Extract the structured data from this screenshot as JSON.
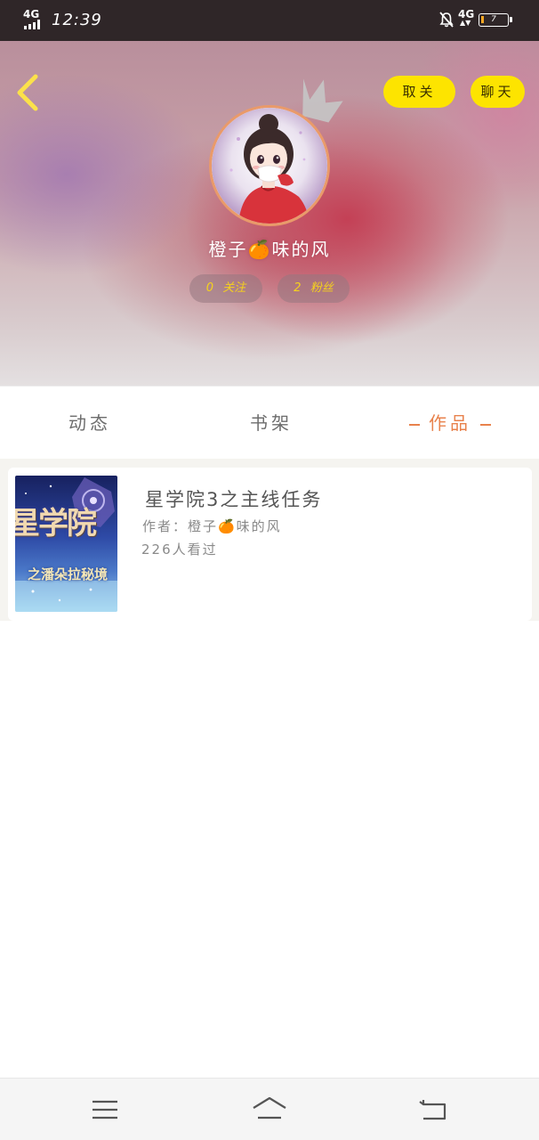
{
  "status_bar": {
    "network": "4G",
    "time": "12:39",
    "network_right": "4G",
    "battery_level": "7"
  },
  "header": {
    "unfollow_label": "取关",
    "chat_label": "聊天",
    "username": "橙子🍊味的风",
    "following_count": "0",
    "following_label": "关注",
    "followers_count": "2",
    "followers_label": "粉丝"
  },
  "tabs": [
    {
      "label": "动态",
      "active": false
    },
    {
      "label": "书架",
      "active": false
    },
    {
      "label": "作品",
      "active": true
    }
  ],
  "works": [
    {
      "title": "星学院3之主线任务",
      "author": "作者：橙子🍊味的风",
      "views": "226人看过",
      "cover_title": "星学院",
      "cover_subtitle": "之潘朵拉秘境"
    }
  ],
  "colors": {
    "accent_orange": "#e8824c",
    "button_yellow": "#fde400",
    "stat_text": "#f6d21c"
  },
  "icons": {
    "back": "chevron-left-icon",
    "menu": "menu-icon",
    "home": "home-icon",
    "nav_back": "return-icon"
  }
}
